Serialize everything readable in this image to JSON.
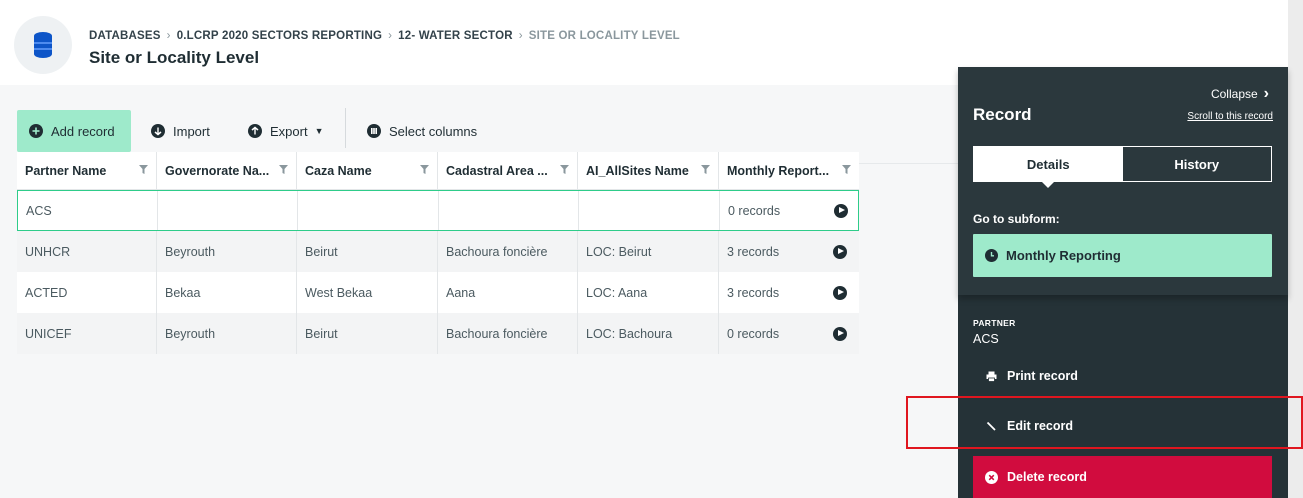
{
  "breadcrumb": {
    "items": [
      "DATABASES",
      "0.LCRP 2020 SECTORS REPORTING",
      "12- WATER SECTOR",
      "SITE OR LOCALITY LEVEL"
    ],
    "separator": "›"
  },
  "page": {
    "title": "Site or Locality Level",
    "icon": "database-icon"
  },
  "toolbar": {
    "add_record": "Add record",
    "import": "Import",
    "export": "Export",
    "export_caret": "▼",
    "select_columns": "Select columns"
  },
  "table": {
    "columns": [
      "Partner Name",
      "Governorate Na...",
      "Caza Name",
      "Cadastral Area ...",
      "AI_AllSites Name",
      "Monthly Report..."
    ],
    "rows": [
      [
        "ACS",
        "",
        "",
        "",
        "",
        "0 records"
      ],
      [
        "UNHCR",
        "Beyrouth",
        "Beirut",
        "Bachoura foncière",
        "LOC: Beirut",
        "3 records"
      ],
      [
        "ACTED",
        "Bekaa",
        "West Bekaa",
        "Aana",
        "LOC: Aana",
        "3 records"
      ],
      [
        "UNICEF",
        "Beyrouth",
        "Beirut",
        "Bachoura foncière",
        "LOC: Bachoura",
        "0 records"
      ]
    ],
    "selected_row": 0
  },
  "panel": {
    "collapse": "Collapse",
    "collapse_icon": "chevron-right-icon",
    "title": "Record",
    "scroll_link": "Scroll to this record",
    "tabs": {
      "details": "Details",
      "history": "History"
    },
    "active_tab": "Details",
    "goto_label": "Go to subform:",
    "subform": "Monthly Reporting",
    "field_label": "PARTNER",
    "field_value": "ACS",
    "print": "Print record",
    "edit": "Edit record",
    "delete": "Delete record"
  },
  "colors": {
    "accent_green": "#9eeacb",
    "selected_border": "#2ecc8a",
    "panel_bg": "#253237",
    "delete_red": "#d10c3e",
    "highlight_red": "#e0161f"
  }
}
